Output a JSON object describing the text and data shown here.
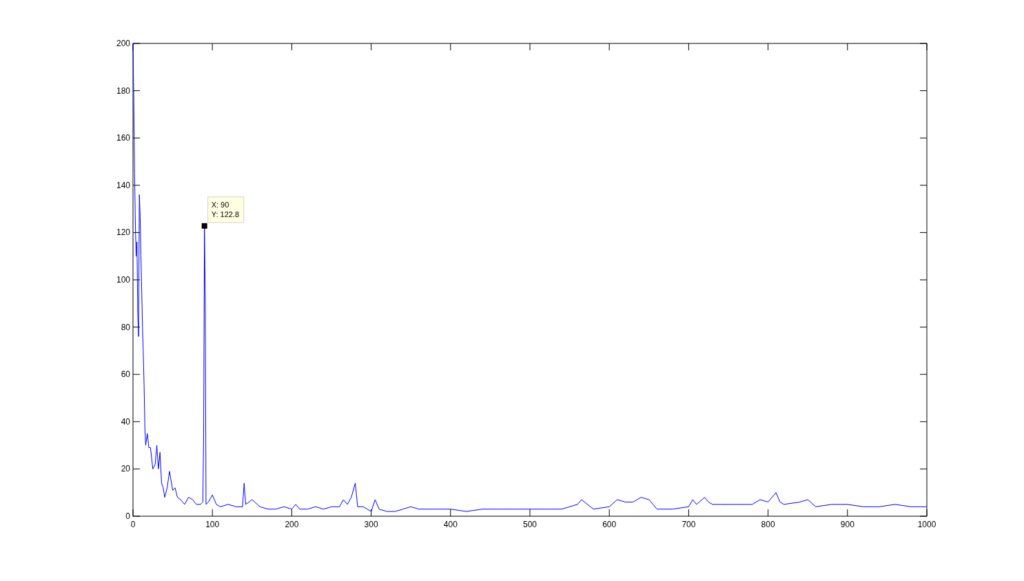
{
  "chart_data": {
    "type": "line",
    "xlim": [
      0,
      1000
    ],
    "ylim": [
      0,
      200
    ],
    "xticks": [
      0,
      100,
      200,
      300,
      400,
      500,
      600,
      700,
      800,
      900,
      1000
    ],
    "yticks": [
      0,
      20,
      40,
      60,
      80,
      100,
      120,
      140,
      160,
      180,
      200
    ],
    "x": [
      0,
      1,
      2,
      3,
      4,
      5,
      6,
      7,
      8,
      9,
      10,
      11,
      12,
      13,
      14,
      15,
      16,
      18,
      20,
      22,
      25,
      28,
      30,
      32,
      34,
      36,
      38,
      40,
      43,
      46,
      50,
      53,
      56,
      60,
      65,
      70,
      75,
      80,
      85,
      88,
      89,
      90,
      91,
      92,
      95,
      100,
      105,
      110,
      120,
      130,
      138,
      140,
      142,
      150,
      160,
      170,
      180,
      190,
      200,
      205,
      210,
      220,
      230,
      240,
      250,
      260,
      265,
      270,
      275,
      280,
      283,
      290,
      300,
      305,
      310,
      320,
      330,
      340,
      350,
      360,
      380,
      400,
      420,
      440,
      460,
      480,
      500,
      520,
      540,
      560,
      565,
      580,
      600,
      610,
      620,
      630,
      640,
      650,
      660,
      680,
      700,
      705,
      710,
      720,
      725,
      730,
      740,
      760,
      780,
      790,
      800,
      810,
      815,
      820,
      840,
      850,
      860,
      880,
      900,
      920,
      940,
      960,
      980,
      1000
    ],
    "series": [
      {
        "color": "#0000ff",
        "values": [
          200,
          176,
          145,
          123,
          110,
          116,
          86,
          76,
          136,
          127,
          110,
          95,
          80,
          68,
          55,
          37,
          30,
          35,
          29,
          29,
          20,
          22,
          30,
          20,
          27,
          14,
          12,
          8,
          12,
          19,
          11,
          12,
          8,
          7,
          5,
          8,
          7,
          5,
          5,
          6,
          35,
          122.8,
          93,
          5,
          6,
          9,
          5,
          4,
          5,
          4,
          4,
          14,
          5,
          7,
          4,
          3,
          3,
          4,
          3,
          5,
          3,
          3,
          4,
          3,
          4,
          4,
          7,
          5,
          8,
          14,
          4,
          4,
          2,
          7,
          3,
          2,
          2,
          3,
          4,
          3,
          3,
          3,
          2,
          3,
          3,
          3,
          3,
          3,
          3,
          5,
          7,
          3,
          4,
          7,
          6,
          6,
          8,
          7,
          3,
          3,
          4,
          7,
          5,
          8,
          6,
          5,
          5,
          5,
          5,
          7,
          6,
          10,
          6,
          5,
          6,
          7,
          4,
          5,
          5,
          4,
          4,
          5,
          4,
          4
        ]
      }
    ],
    "annotations": [
      {
        "x": 90,
        "y": 122.8,
        "text": "X: 90\nY: 122.8"
      }
    ]
  }
}
